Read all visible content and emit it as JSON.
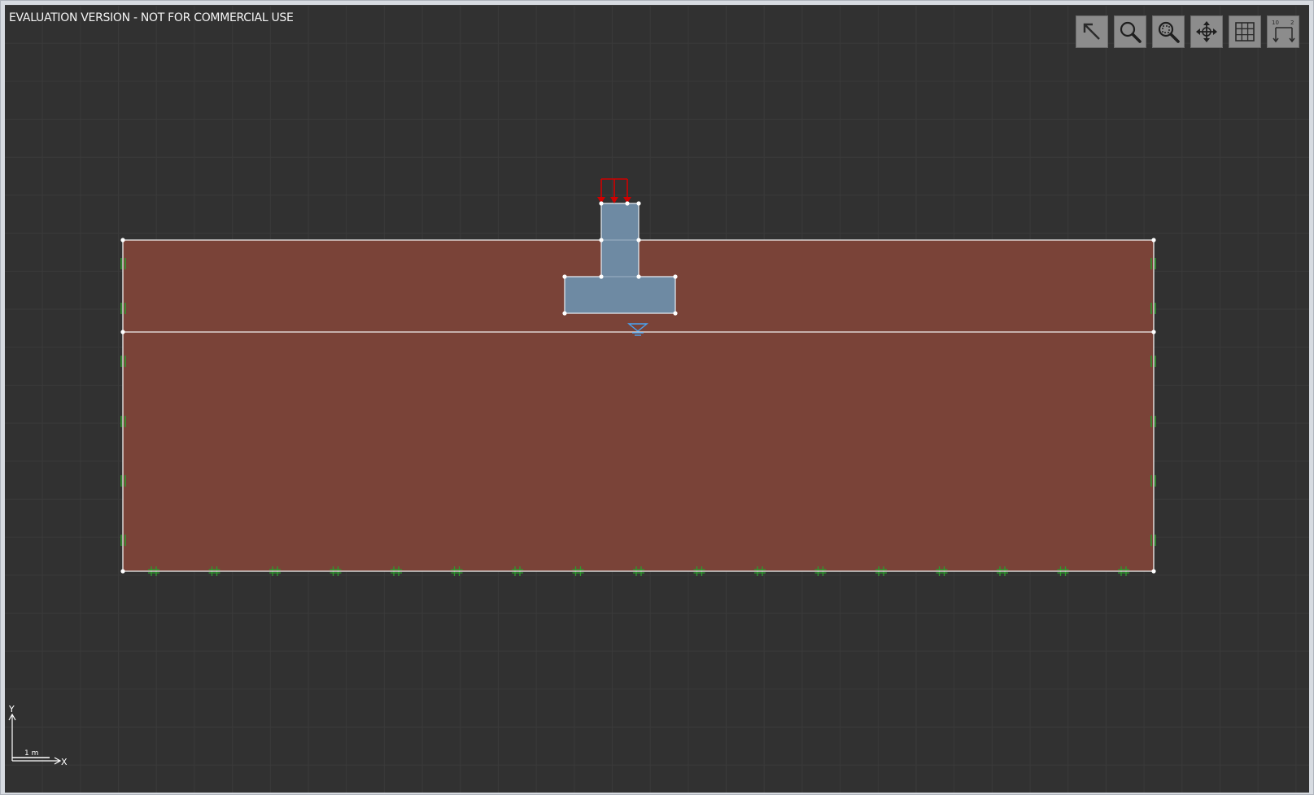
{
  "watermark": "EVALUATION VERSION - NOT FOR COMMERCIAL USE",
  "toolbar": [
    {
      "name": "select-arrow-icon"
    },
    {
      "name": "zoom-icon"
    },
    {
      "name": "zoom-extents-icon"
    },
    {
      "name": "pan-icon"
    },
    {
      "name": "grid-icon"
    },
    {
      "name": "dimension-icon",
      "labels": [
        "10",
        "2"
      ]
    }
  ],
  "axes": {
    "x_label": "X",
    "y_label": "Y",
    "scale_label": "1 m"
  },
  "colors": {
    "background": "#313131",
    "soil": "#7a4338",
    "footing": "#6e8aa3",
    "load": "#d00000",
    "water_table": "#4aa3f0",
    "support": "#2e9b2e",
    "edges": "#f2f2f2"
  }
}
